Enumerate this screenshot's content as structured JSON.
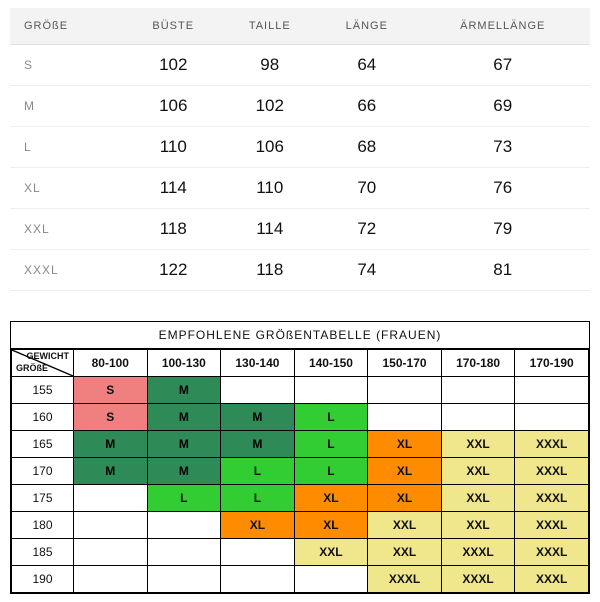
{
  "measurements": {
    "headers": [
      "GRÖßE",
      "BÜSTE",
      "TAILLE",
      "LÄNGE",
      "ÄRMELLÄNGE"
    ],
    "rows": [
      {
        "size": "S",
        "bust": "102",
        "waist": "98",
        "length": "64",
        "sleeve": "67"
      },
      {
        "size": "M",
        "bust": "106",
        "waist": "102",
        "length": "66",
        "sleeve": "69"
      },
      {
        "size": "L",
        "bust": "110",
        "waist": "106",
        "length": "68",
        "sleeve": "73"
      },
      {
        "size": "XL",
        "bust": "114",
        "waist": "110",
        "length": "70",
        "sleeve": "76"
      },
      {
        "size": "XXL",
        "bust": "118",
        "waist": "114",
        "length": "72",
        "sleeve": "79"
      },
      {
        "size": "XXXL",
        "bust": "122",
        "waist": "118",
        "length": "74",
        "sleeve": "81"
      }
    ]
  },
  "recommend": {
    "title": "EMPFOHLENE GRÖßENTABELLE (FRAUEN)",
    "axis_weight": "GEWICHT",
    "axis_height": "GRÖßE",
    "weights": [
      "80-100",
      "100-130",
      "130-140",
      "140-150",
      "150-170",
      "170-180",
      "170-190"
    ],
    "heights": [
      "155",
      "160",
      "165",
      "170",
      "175",
      "180",
      "185",
      "190"
    ],
    "grid": [
      [
        {
          "v": "S",
          "c": "pink"
        },
        {
          "v": "M",
          "c": "dg"
        },
        null,
        null,
        null,
        null,
        null
      ],
      [
        {
          "v": "S",
          "c": "pink"
        },
        {
          "v": "M",
          "c": "dg"
        },
        {
          "v": "M",
          "c": "dg"
        },
        {
          "v": "L",
          "c": "lg"
        },
        null,
        null,
        null
      ],
      [
        {
          "v": "M",
          "c": "dg"
        },
        {
          "v": "M",
          "c": "dg"
        },
        {
          "v": "M",
          "c": "dg"
        },
        {
          "v": "L",
          "c": "lg"
        },
        {
          "v": "XL",
          "c": "or"
        },
        {
          "v": "XXL",
          "c": "yl"
        },
        {
          "v": "XXXL",
          "c": "yl"
        }
      ],
      [
        {
          "v": "M",
          "c": "dg"
        },
        {
          "v": "M",
          "c": "dg"
        },
        {
          "v": "L",
          "c": "lg"
        },
        {
          "v": "L",
          "c": "lg"
        },
        {
          "v": "XL",
          "c": "or"
        },
        {
          "v": "XXL",
          "c": "yl"
        },
        {
          "v": "XXXL",
          "c": "yl"
        }
      ],
      [
        null,
        {
          "v": "L",
          "c": "lg"
        },
        {
          "v": "L",
          "c": "lg"
        },
        {
          "v": "XL",
          "c": "or"
        },
        {
          "v": "XL",
          "c": "or"
        },
        {
          "v": "XXL",
          "c": "yl"
        },
        {
          "v": "XXXL",
          "c": "yl"
        }
      ],
      [
        null,
        null,
        {
          "v": "XL",
          "c": "or"
        },
        {
          "v": "XL",
          "c": "or"
        },
        {
          "v": "XXL",
          "c": "yl"
        },
        {
          "v": "XXL",
          "c": "yl"
        },
        {
          "v": "XXXL",
          "c": "yl"
        }
      ],
      [
        null,
        null,
        null,
        {
          "v": "XXL",
          "c": "yl"
        },
        {
          "v": "XXL",
          "c": "yl"
        },
        {
          "v": "XXXL",
          "c": "yl"
        },
        {
          "v": "XXXL",
          "c": "yl"
        }
      ],
      [
        null,
        null,
        null,
        null,
        {
          "v": "XXXL",
          "c": "yl"
        },
        {
          "v": "XXXL",
          "c": "yl"
        },
        {
          "v": "XXXL",
          "c": "yl"
        }
      ]
    ]
  }
}
